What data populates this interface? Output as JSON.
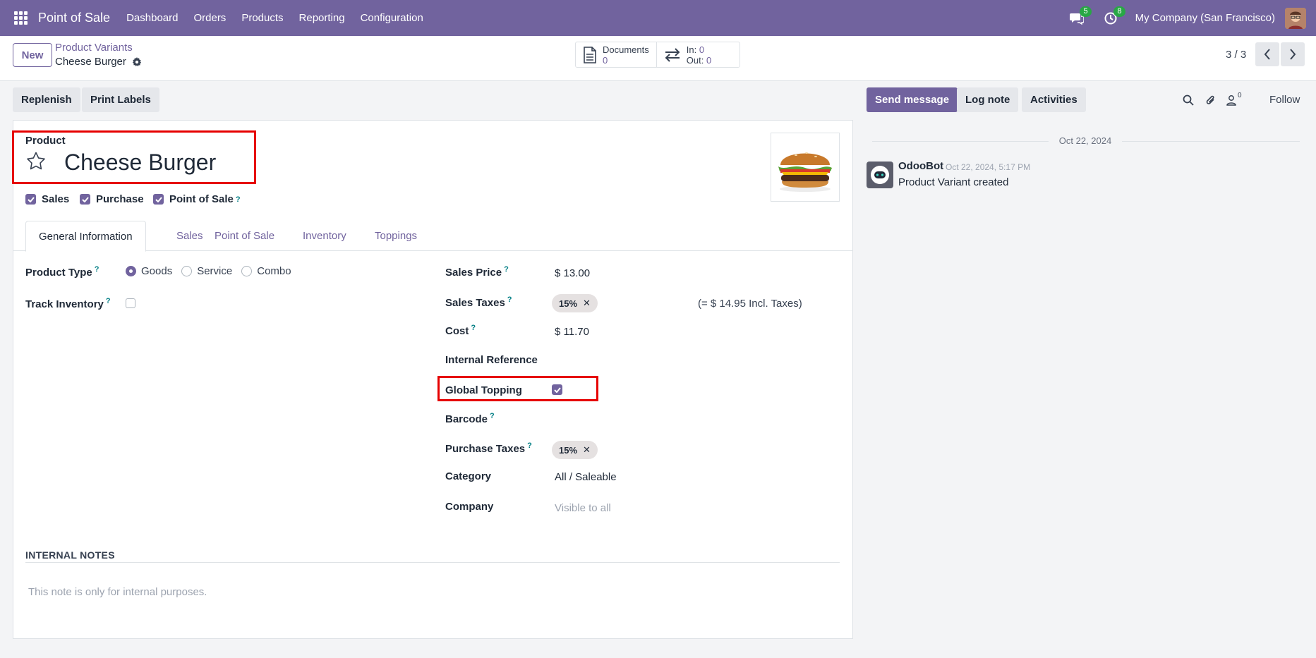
{
  "navbar": {
    "app_name": "Point of Sale",
    "menu": [
      "Dashboard",
      "Orders",
      "Products",
      "Reporting",
      "Configuration"
    ],
    "messages_count": "5",
    "activities_count": "8",
    "company": "My Company (San Francisco)"
  },
  "control": {
    "new_label": "New",
    "breadcrumb_parent": "Product Variants",
    "breadcrumb_current": "Cheese Burger",
    "documents_label": "Documents",
    "documents_count": "0",
    "in_label": "In:",
    "in_count": "0",
    "out_label": "Out:",
    "out_count": "0",
    "pager": "3 / 3"
  },
  "actions": {
    "replenish": "Replenish",
    "print_labels": "Print Labels",
    "send_message": "Send message",
    "log_note": "Log note",
    "activities": "Activities",
    "followers_count": "0",
    "follow": "Follow"
  },
  "form": {
    "product_label": "Product",
    "product_name": "Cheese Burger",
    "checkboxes": [
      {
        "label": "Sales",
        "checked": true
      },
      {
        "label": "Purchase",
        "checked": true
      },
      {
        "label": "Point of Sale",
        "checked": true
      }
    ],
    "tabs": [
      "General Information",
      "Sales",
      "Point of Sale",
      "Inventory",
      "Toppings"
    ],
    "product_type_label": "Product Type",
    "product_type_options": [
      "Goods",
      "Service",
      "Combo"
    ],
    "product_type_selected": "Goods",
    "track_inventory_label": "Track Inventory",
    "sales_price_label": "Sales Price",
    "sales_price": "$ 13.00",
    "sales_taxes_label": "Sales Taxes",
    "sales_tax_tag": "15%",
    "incl_taxes": "(= $ 14.95 Incl. Taxes)",
    "cost_label": "Cost",
    "cost": "$ 11.70",
    "internal_ref_label": "Internal Reference",
    "global_topping_label": "Global Topping",
    "barcode_label": "Barcode",
    "purchase_taxes_label": "Purchase Taxes",
    "purchase_tax_tag": "15%",
    "category_label": "Category",
    "category": "All / Saleable",
    "company_label": "Company",
    "company_placeholder": "Visible to all",
    "notes_title": "INTERNAL NOTES",
    "notes_placeholder": "This note is only for internal purposes."
  },
  "chatter": {
    "date": "Oct 22, 2024",
    "author": "OdooBot",
    "time": "Oct 22, 2024, 5:17 PM",
    "body": "Product Variant created"
  },
  "colors": {
    "brand": "#71639e",
    "highlight": "#e60000",
    "help": "#017e84"
  }
}
